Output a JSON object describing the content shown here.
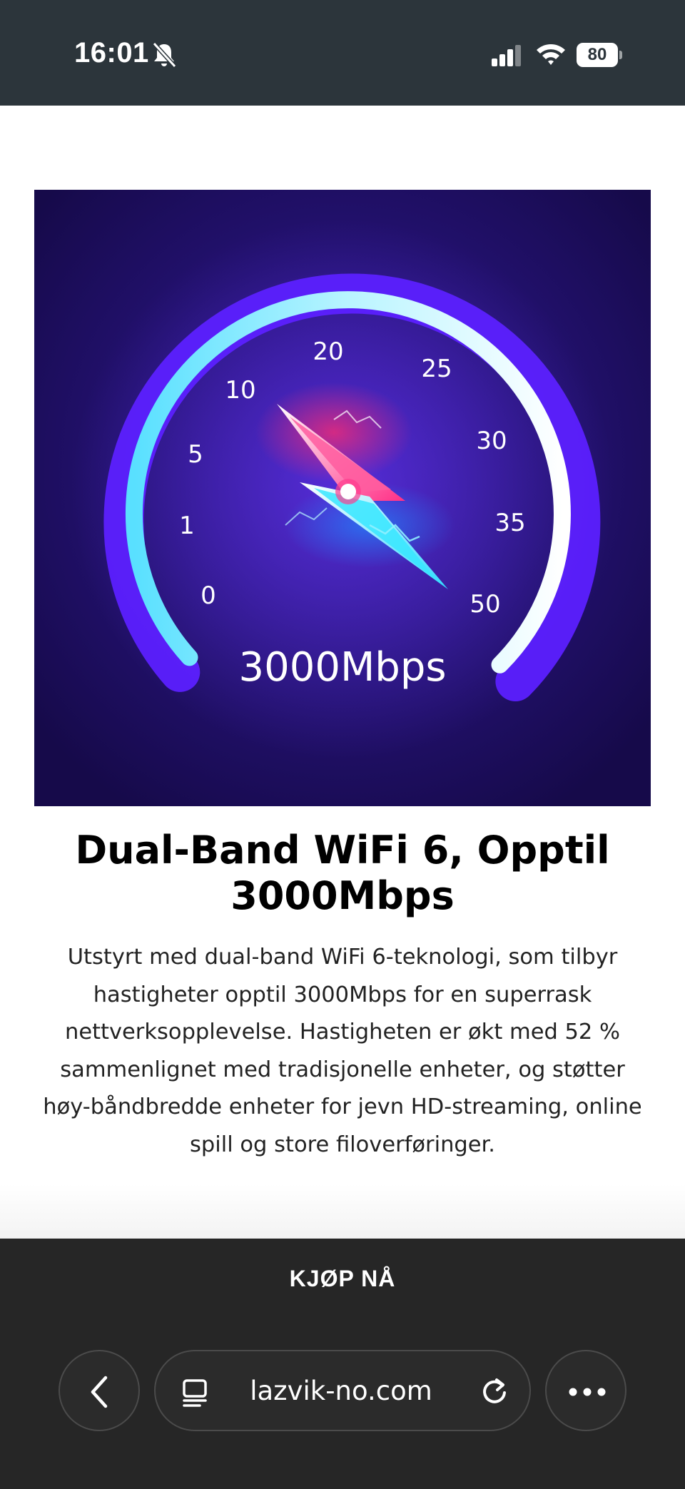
{
  "status_bar": {
    "time": "16:01",
    "battery_level": "80",
    "icons": [
      "bell-slash-icon",
      "cellular-signal-icon",
      "wifi-icon",
      "battery-icon"
    ]
  },
  "speed_gauge": {
    "labels": [
      "0",
      "1",
      "5",
      "10",
      "20",
      "25",
      "30",
      "35",
      "50"
    ],
    "speed": "3000Mbps",
    "colors": {
      "background": "#1d0f5a",
      "arc_outer": "#5a1cff",
      "arc_inner": "#7ef2ff",
      "needle_pink": "#ff3b8e",
      "needle_cyan": "#3fe3ff"
    }
  },
  "feature": {
    "title": "Dual-Band WiFi 6, Opptil 3000Mbps",
    "description": "Utstyrt med dual-band WiFi 6-teknologi, som tilbyr hastigheter opptil 3000Mbps for en superrask nettverksopplevelse. Hastigheten er økt med 52 % sammenlignet med tradisjonelle enheter, og støtter høy-båndbredde enheter for jevn HD-streaming, online spill og store filoverføringer."
  },
  "bottom_bar": {
    "buy_label": "KJØP NÅ",
    "url": "lazvik-no.com",
    "icons": [
      "chevron-left-icon",
      "tab-view-icon",
      "reload-icon",
      "more-icon"
    ]
  }
}
